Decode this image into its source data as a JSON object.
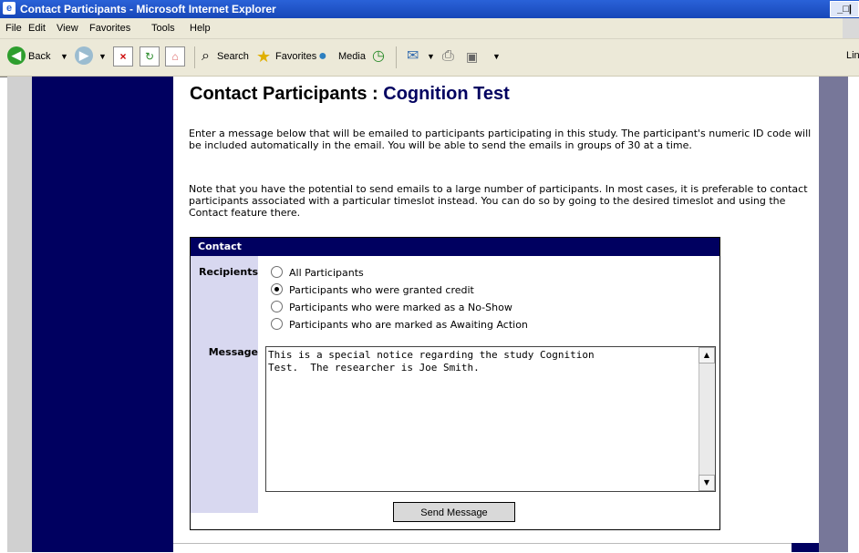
{
  "window": {
    "title": "Contact Participants - Microsoft Internet Explorer",
    "controls": "_□|"
  },
  "menubar": {
    "items": [
      "File",
      "Edit",
      "View",
      "Favorites",
      "Tools",
      "Help"
    ]
  },
  "toolbar": {
    "back_label": "Back",
    "search_label": "Search",
    "favorites_label": "Favorites",
    "media_label": "Media",
    "links_label": "Link"
  },
  "page": {
    "title_prefix": "Contact Participants : ",
    "study_name": "Cognition Test",
    "paragraph1": "Enter a message below that will be emailed to participants participating in this study. The participant's numeric ID code will be included automatically in the email. You will be able to send the emails in groups of 30 at a time.",
    "paragraph2": "Note that you have the potential to send emails to a large number of participants. In most cases, it is preferable to contact participants associated with a particular timeslot instead. You can do so by going to the desired timeslot and using the Contact feature there."
  },
  "contact_panel": {
    "header": "Contact",
    "recipients_label": "Recipients",
    "message_label": "Message",
    "options": [
      {
        "label": "All Participants",
        "checked": false
      },
      {
        "label": "Participants who were granted credit",
        "checked": true
      },
      {
        "label": "Participants who were marked as a No-Show",
        "checked": false
      },
      {
        "label": "Participants who are marked as Awaiting Action",
        "checked": false
      }
    ],
    "message_text": "This is a special notice regarding the study Cognition\nTest.  The researcher is Joe Smith.",
    "send_button": "Send Message"
  },
  "colors": {
    "navy": "#000060",
    "purple_strip": "#777799",
    "label_bg": "#d8d8f0",
    "xp_blue": "#2a62d8"
  }
}
